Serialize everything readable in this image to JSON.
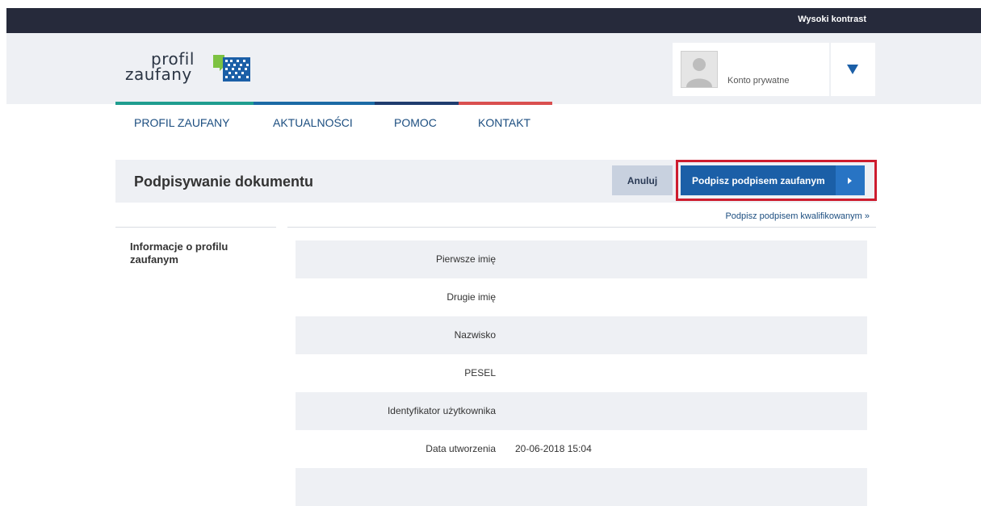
{
  "topbar": {
    "high_contrast": "Wysoki kontrast"
  },
  "logo": {
    "line1": "profil",
    "line2": "zaufany"
  },
  "account": {
    "label": "Konto prywatne"
  },
  "nav": {
    "items": [
      {
        "label": "PROFIL ZAUFANY"
      },
      {
        "label": "AKTUALNOŚCI"
      },
      {
        "label": "POMOC"
      },
      {
        "label": "KONTAKT"
      }
    ],
    "stripe_colors": [
      "#1f9d8f",
      "#1b6aa5",
      "#1f3c6e",
      "#d94f4f"
    ]
  },
  "page": {
    "title": "Podpisywanie dokumentu",
    "cancel_label": "Anuluj",
    "sign_label": "Podpisz podpisem zaufanym",
    "qualified_link": "Podpisz podpisem kwalifikowanym »"
  },
  "section": {
    "title": "Informacje o profilu zaufanym",
    "rows": [
      {
        "label": "Pierwsze imię",
        "value": ""
      },
      {
        "label": "Drugie imię",
        "value": ""
      },
      {
        "label": "Nazwisko",
        "value": ""
      },
      {
        "label": "PESEL",
        "value": ""
      },
      {
        "label": "Identyfikator użytkownika",
        "value": ""
      },
      {
        "label": "Data utworzenia",
        "value": "20-06-2018 15:04"
      },
      {
        "label": "",
        "value": ""
      }
    ]
  },
  "colors": {
    "primary": "#1b5fa7",
    "highlight": "#cd1c2e",
    "topbar": "#262a3b"
  }
}
